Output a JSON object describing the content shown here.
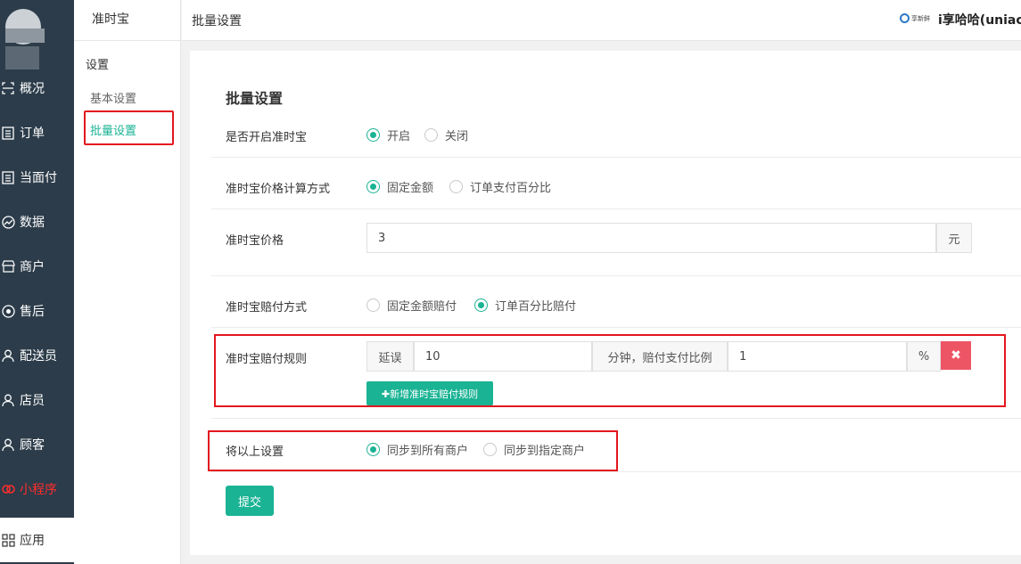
{
  "nav": {
    "items": [
      {
        "label": "概况",
        "icon": "overview-icon"
      },
      {
        "label": "订单",
        "icon": "order-icon"
      },
      {
        "label": "当面付",
        "icon": "pay-icon"
      },
      {
        "label": "数据",
        "icon": "chart-icon"
      },
      {
        "label": "商户",
        "icon": "store-icon"
      },
      {
        "label": "售后",
        "icon": "service-icon"
      },
      {
        "label": "配送员",
        "icon": "courier-icon"
      },
      {
        "label": "店员",
        "icon": "clerk-icon"
      },
      {
        "label": "顾客",
        "icon": "customer-icon"
      },
      {
        "label": "小程序",
        "icon": "miniprogram-icon"
      },
      {
        "label": "应用",
        "icon": "apps-icon"
      }
    ]
  },
  "sub": {
    "title": "准时宝",
    "section": "设置",
    "items": [
      "基本设置",
      "批量设置"
    ]
  },
  "topbar": {
    "title": "批量设置",
    "brand": "享新鲜",
    "user": "i享哈哈(uniaci"
  },
  "form": {
    "title": "批量设置",
    "enable": {
      "label": "是否开启准时宝",
      "options": [
        "开启",
        "关闭"
      ]
    },
    "calc": {
      "label": "准时宝价格计算方式",
      "options": [
        "固定金额",
        "订单支付百分比"
      ]
    },
    "price": {
      "label": "准时宝价格",
      "value": "3",
      "unit": "元"
    },
    "comp": {
      "label": "准时宝赔付方式",
      "options": [
        "固定金额赔付",
        "订单百分比赔付"
      ]
    },
    "rule": {
      "label": "准时宝赔付规则",
      "prefix": "延误",
      "minutes": "10",
      "middle": "分钟，赔付支付比例",
      "ratio": "1",
      "suffix": "%",
      "delete_symbol": "✖",
      "add_label": "✚新增准时宝赔付规则"
    },
    "sync": {
      "label": "将以上设置",
      "options": [
        "同步到所有商户",
        "同步到指定商户"
      ]
    },
    "submit": "提交"
  },
  "colors": {
    "accent": "#1ab394",
    "danger": "#ed5565",
    "nav_bg": "#2c3c4a",
    "highlight": "#e3171e"
  }
}
